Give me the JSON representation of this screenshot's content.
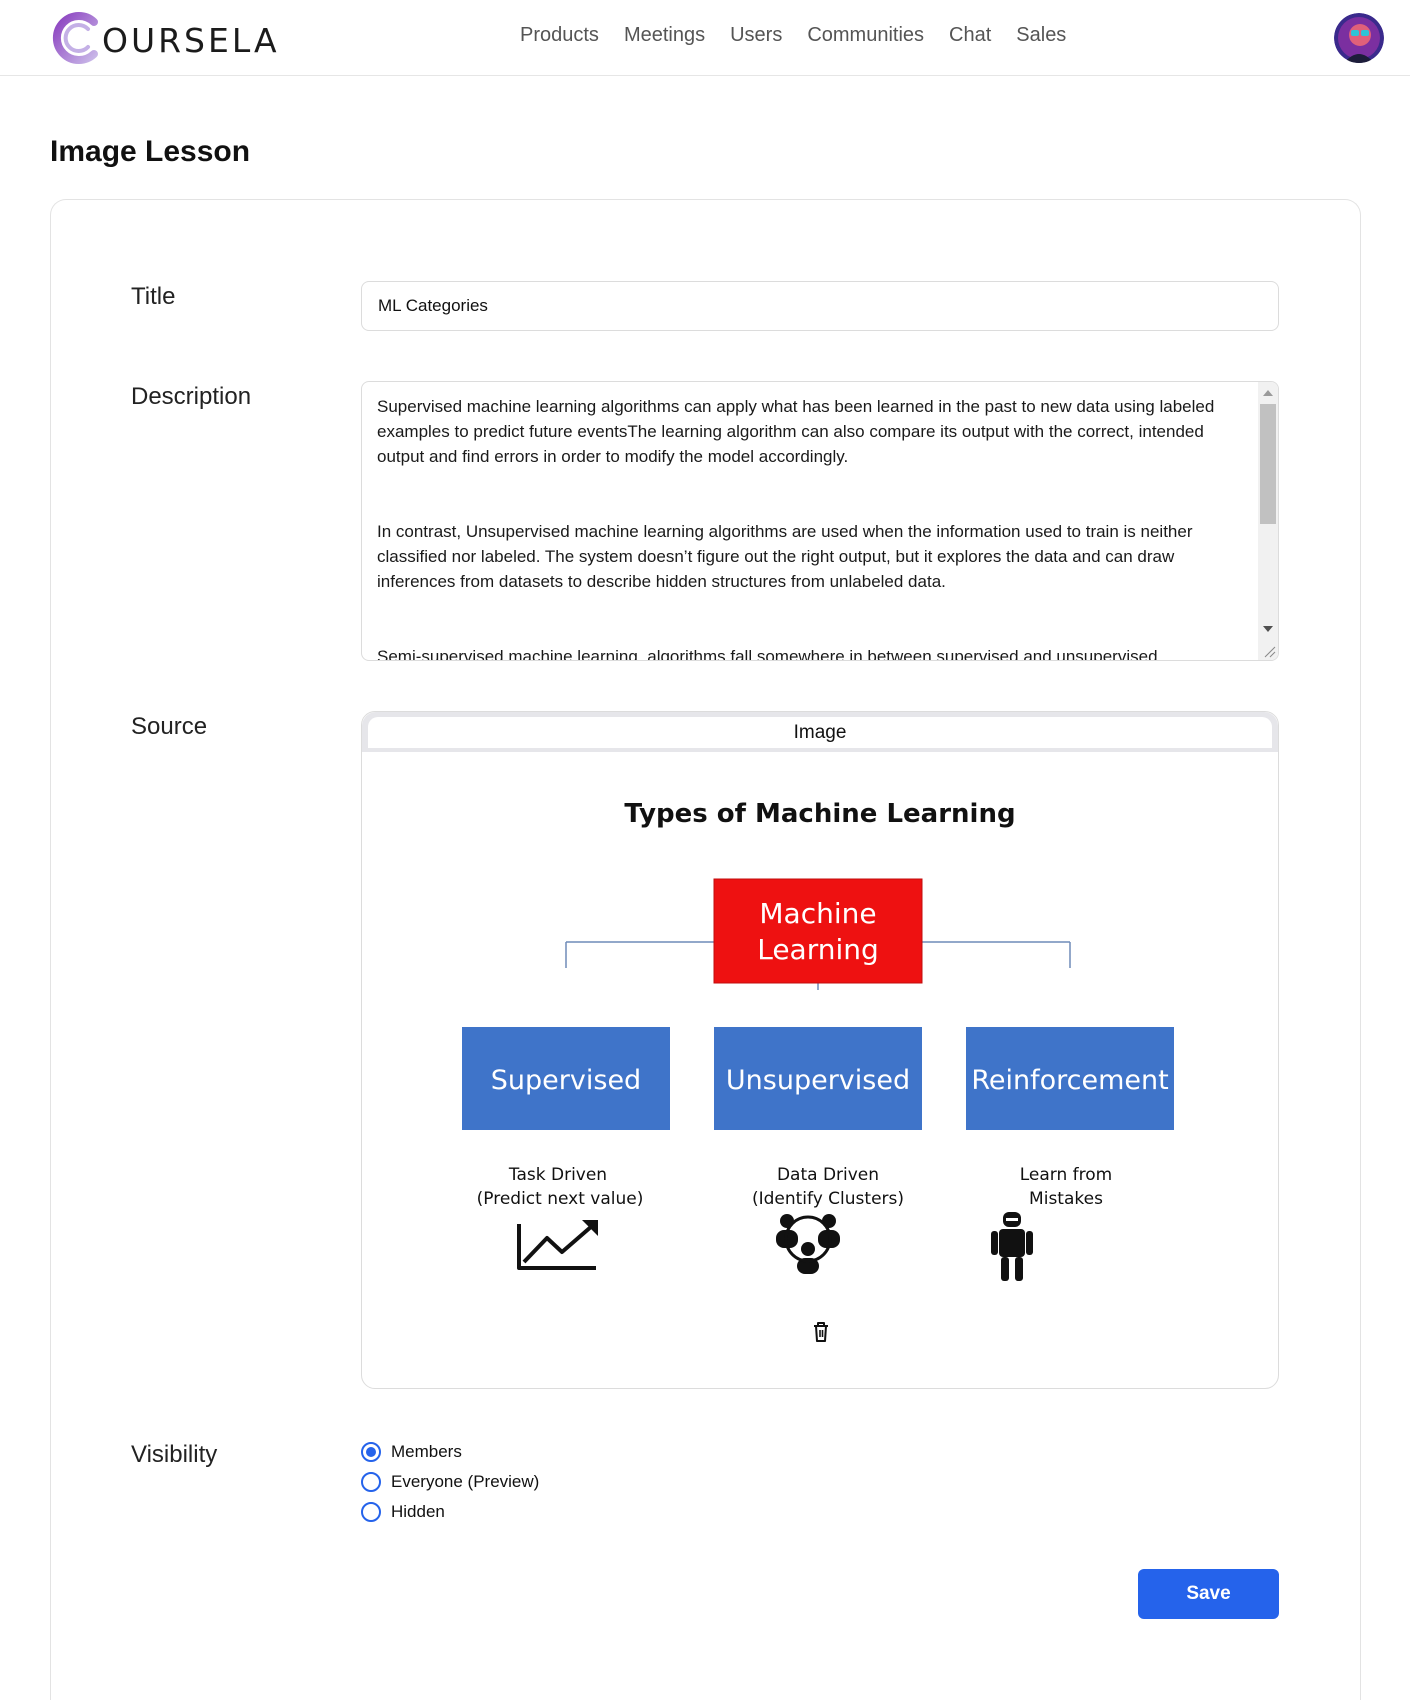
{
  "header": {
    "logo_text": "OURSELA",
    "nav": [
      {
        "label": "Products"
      },
      {
        "label": "Meetings"
      },
      {
        "label": "Users"
      },
      {
        "label": "Communities"
      },
      {
        "label": "Chat"
      },
      {
        "label": "Sales"
      }
    ],
    "avatar_icon": "user-avatar"
  },
  "page": {
    "title": "Image Lesson"
  },
  "form": {
    "title_label": "Title",
    "title_value": "ML Categories",
    "description_label": "Description",
    "description_value": "Supervised machine learning algorithms can apply what has been learned in the past to new data using labeled examples to predict future eventsThe learning algorithm can also compare its output with the correct, intended output and find errors in order to modify the model accordingly.\n\n\nIn contrast, Unsupervised machine learning algorithms are used when the information used to train is neither classified nor labeled. The system doesn’t figure out the right output, but it explores the data and can draw inferences from datasets to describe hidden structures from unlabeled data.\n\n\nSemi-supervised machine learning  algorithms fall somewhere in between supervised and unsupervised",
    "source_label": "Source",
    "source_tab": "Image",
    "visibility_label": "Visibility",
    "visibility_options": [
      {
        "label": "Members",
        "checked": true
      },
      {
        "label": "Everyone (Preview)",
        "checked": false
      },
      {
        "label": "Hidden",
        "checked": false
      }
    ],
    "save_label": "Save"
  },
  "image_diagram": {
    "title": "Types of Machine Learning",
    "root": "Machine Learning",
    "root_lines": [
      "Machine",
      "Learning"
    ],
    "root_color": "#ee1111",
    "child_color": "#3f74c9",
    "children": [
      {
        "label": "Supervised",
        "caption": [
          "Task Driven",
          "(Predict next value)"
        ],
        "icon": "trend-chart-icon"
      },
      {
        "label": "Unsupervised",
        "caption": [
          "Data Driven",
          "(Identify Clusters)"
        ],
        "icon": "people-cluster-icon"
      },
      {
        "label": "Reinforcement",
        "caption": [
          "Learn from",
          "Mistakes"
        ],
        "icon": "robot-icon"
      }
    ]
  },
  "colors": {
    "accent": "#2563eb",
    "border": "#dcdcdc"
  }
}
